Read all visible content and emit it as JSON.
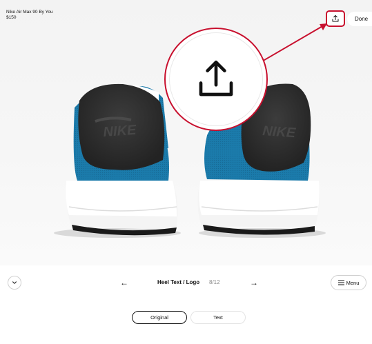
{
  "product": {
    "name": "Nike Air Max 90 By You",
    "price": "$150"
  },
  "header": {
    "share_icon": "share-icon",
    "done_label": "Done"
  },
  "callout": {
    "icon": "share-icon",
    "accent_color": "#c8102e"
  },
  "preview": {
    "brand_text": "NIKE",
    "shoe_color": "#1b7bab"
  },
  "step_nav": {
    "collapse_icon": "chevron-down-icon",
    "prev_icon": "arrow-left-icon",
    "next_icon": "arrow-right-icon",
    "title": "Heel Text / Logo",
    "count": "8/12",
    "menu_label": "Menu",
    "menu_icon": "hamburger-icon"
  },
  "options": [
    {
      "label": "Original",
      "selected": true
    },
    {
      "label": "Text",
      "selected": false
    }
  ]
}
